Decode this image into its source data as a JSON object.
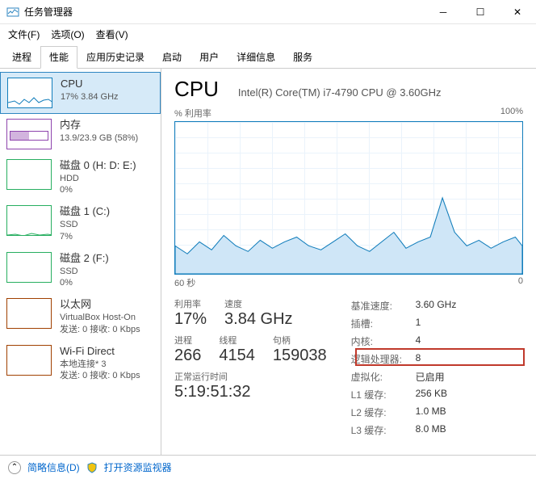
{
  "window": {
    "title": "任务管理器"
  },
  "menu": {
    "file": "文件(F)",
    "options": "选项(O)",
    "view": "查看(V)"
  },
  "tabs": [
    "进程",
    "性能",
    "应用历史记录",
    "启动",
    "用户",
    "详细信息",
    "服务"
  ],
  "sidebar": [
    {
      "title": "CPU",
      "sub": "17% 3.84 GHz",
      "kind": "cpu"
    },
    {
      "title": "内存",
      "sub": "13.9/23.9 GB (58%)",
      "kind": "mem"
    },
    {
      "title": "磁盘 0 (H: D: E:)",
      "sub": "HDD",
      "sub2": "0%",
      "kind": "disk"
    },
    {
      "title": "磁盘 1 (C:)",
      "sub": "SSD",
      "sub2": "7%",
      "kind": "disk"
    },
    {
      "title": "磁盘 2 (F:)",
      "sub": "SSD",
      "sub2": "0%",
      "kind": "disk"
    },
    {
      "title": "以太网",
      "sub": "VirtualBox Host-On",
      "sub2": "发送: 0 接收: 0 Kbps",
      "kind": "eth"
    },
    {
      "title": "Wi-Fi Direct",
      "sub": "本地连接* 3",
      "sub2": "发送: 0 接收: 0 Kbps",
      "kind": "eth"
    }
  ],
  "main": {
    "title": "CPU",
    "model": "Intel(R) Core(TM) i7-4790 CPU @ 3.60GHz",
    "chart_ylabel": "% 利用率",
    "chart_ymax": "100%",
    "chart_xleft": "60 秒",
    "chart_xright": "0",
    "stats": {
      "util_label": "利用率",
      "util": "17%",
      "speed_label": "速度",
      "speed": "3.84 GHz",
      "proc_label": "进程",
      "proc": "266",
      "thread_label": "线程",
      "thread": "4154",
      "handle_label": "句柄",
      "handle": "159038",
      "uptime_label": "正常运行时间",
      "uptime": "5:19:51:32"
    },
    "info": {
      "base_speed_k": "基准速度:",
      "base_speed_v": "3.60 GHz",
      "sockets_k": "插槽:",
      "sockets_v": "1",
      "cores_k": "内核:",
      "cores_v": "4",
      "lproc_k": "逻辑处理器:",
      "lproc_v": "8",
      "virt_k": "虚拟化:",
      "virt_v": "已启用",
      "l1_k": "L1 缓存:",
      "l1_v": "256 KB",
      "l2_k": "L2 缓存:",
      "l2_v": "1.0 MB",
      "l3_k": "L3 缓存:",
      "l3_v": "8.0 MB"
    }
  },
  "footer": {
    "brief": "简略信息(D)",
    "monitor": "打开资源监视器"
  },
  "chart_data": {
    "type": "line",
    "title": "% 利用率",
    "ylabel": "% 利用率",
    "ylim": [
      0,
      100
    ],
    "xlim_seconds": [
      60,
      0
    ],
    "values_pct": [
      18,
      12,
      20,
      15,
      25,
      18,
      14,
      22,
      16,
      20,
      24,
      18,
      15,
      20,
      26,
      18,
      14,
      20,
      28,
      16,
      20,
      24,
      50,
      28,
      18,
      22,
      16,
      20,
      24,
      18
    ]
  }
}
